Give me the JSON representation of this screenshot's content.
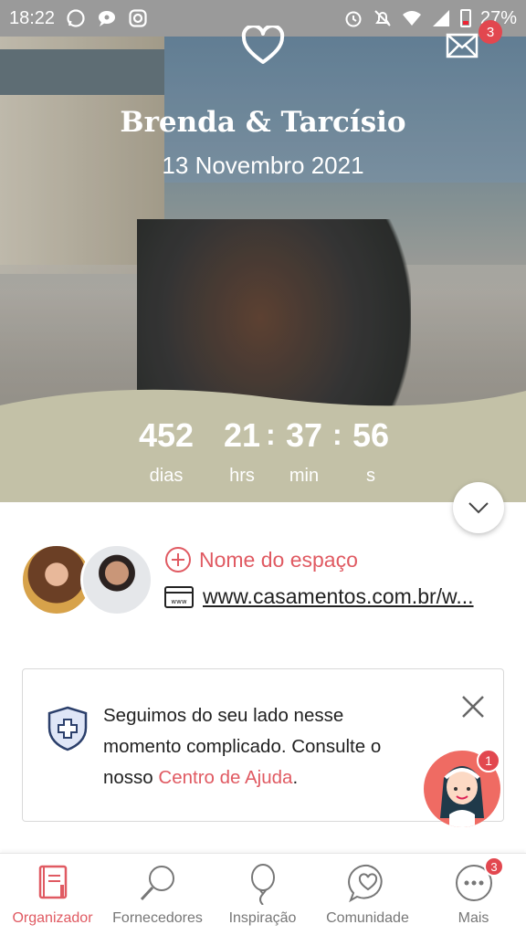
{
  "status_bar": {
    "time": "18:22",
    "battery": "27%",
    "icons": [
      "whatsapp-icon",
      "chat-icon",
      "instagram-icon",
      "alarm-icon",
      "mute-icon",
      "wifi-icon",
      "signal-icon",
      "battery-icon"
    ]
  },
  "hero": {
    "couple_names": "Brenda & Tarcísio",
    "wedding_date": "13 Novembro 2021",
    "messages_badge": "3",
    "band_color": "#c3c1a7"
  },
  "countdown": {
    "days": "452",
    "days_label": "dias",
    "hours": "21",
    "hours_label": "hrs",
    "minutes": "37",
    "minutes_label": "min",
    "seconds": "56",
    "seconds_label": "s",
    "separator": ":"
  },
  "couple_info": {
    "add_venue_label": "Nome do espaço",
    "website_url": "www.casamentos.com.br/w..."
  },
  "help_card": {
    "text_before": "Seguimos do seu lado nesse momento complicado. Consulte o nosso ",
    "link_text": "Centro de Ajuda",
    "text_after": ".",
    "assistant_badge": "1"
  },
  "bottom_nav": {
    "items": [
      {
        "label": "Organizador",
        "icon": "notebook-icon",
        "active": true
      },
      {
        "label": "Fornecedores",
        "icon": "search-icon",
        "active": false
      },
      {
        "label": "Inspiração",
        "icon": "balloon-icon",
        "active": false
      },
      {
        "label": "Comunidade",
        "icon": "chat-heart-icon",
        "active": false
      },
      {
        "label": "Mais",
        "icon": "more-icon",
        "active": false
      }
    ],
    "more_badge": "3"
  },
  "colors": {
    "accent": "#e05a62",
    "badge": "#e2474f",
    "status_bar": "#9a9a9a"
  }
}
